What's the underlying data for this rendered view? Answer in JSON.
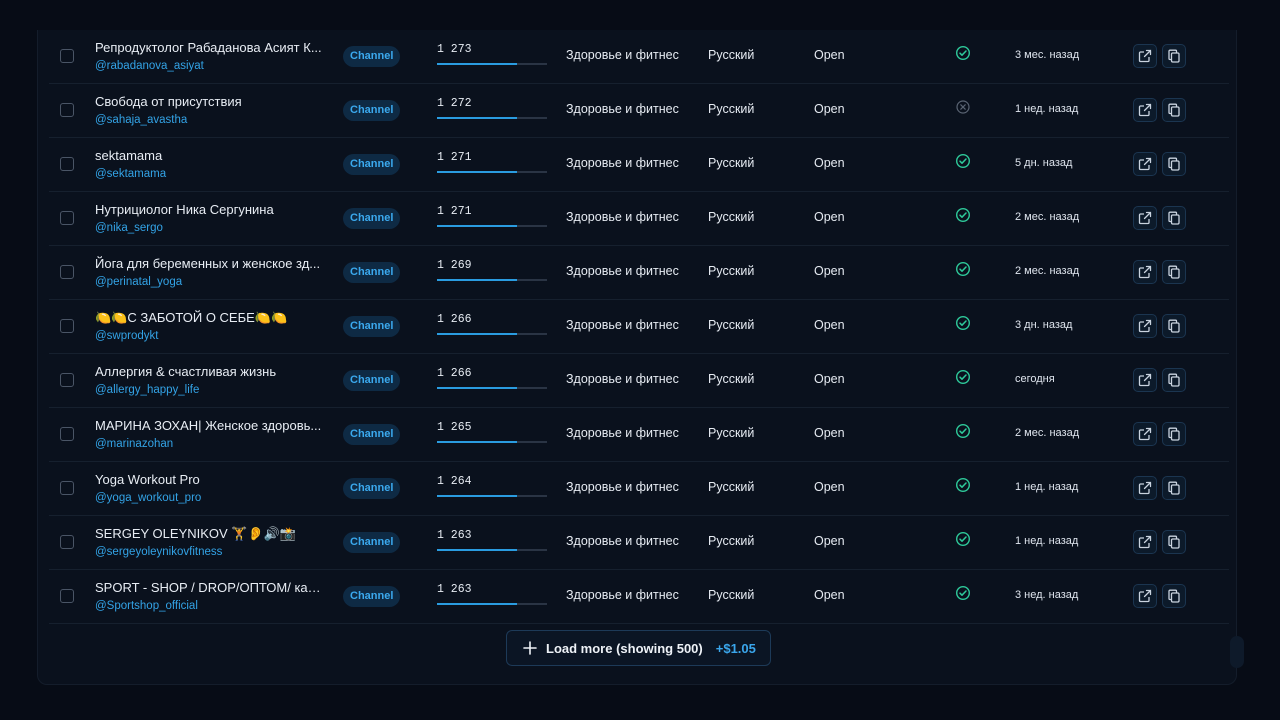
{
  "badge_label": "Channel",
  "colors": {
    "accent": "#2a9ce0",
    "verified": "#2ec99a",
    "unverified": "#5a6473"
  },
  "icons": {
    "verified": "check-circle-icon",
    "unverified": "x-circle-icon",
    "open": "external-link-icon",
    "copy": "copy-icon",
    "load_more": "plus-icon"
  },
  "rows": [
    {
      "name": "Репродуктолог Рабаданова Асият К...",
      "handle": "@rabadanova_asiyat",
      "subscribers": "1 273",
      "fill": 0.73,
      "category": "Здоровье и фитнес",
      "language": "Русский",
      "status": "Open",
      "verified": true,
      "updated": "3 мес. назад"
    },
    {
      "name": "Свобода от присутствия",
      "handle": "@sahaja_avastha",
      "subscribers": "1 272",
      "fill": 0.73,
      "category": "Здоровье и фитнес",
      "language": "Русский",
      "status": "Open",
      "verified": false,
      "updated": "1 нед. назад"
    },
    {
      "name": "sektamama",
      "handle": "@sektamama",
      "subscribers": "1 271",
      "fill": 0.73,
      "category": "Здоровье и фитнес",
      "language": "Русский",
      "status": "Open",
      "verified": true,
      "updated": "5 дн. назад"
    },
    {
      "name": "Нутрициолог Ника Сергунина",
      "handle": "@nika_sergo",
      "subscribers": "1 271",
      "fill": 0.73,
      "category": "Здоровье и фитнес",
      "language": "Русский",
      "status": "Open",
      "verified": true,
      "updated": "2 мес. назад"
    },
    {
      "name": "Йога для беременных и женское зд...",
      "handle": "@perinatal_yoga",
      "subscribers": "1 269",
      "fill": 0.73,
      "category": "Здоровье и фитнес",
      "language": "Русский",
      "status": "Open",
      "verified": true,
      "updated": "2 мес. назад"
    },
    {
      "name": "🍋🍋С ЗАБОТОЙ О СЕБЕ🍋🍋",
      "handle": "@swprodykt",
      "subscribers": "1 266",
      "fill": 0.73,
      "category": "Здоровье и фитнес",
      "language": "Русский",
      "status": "Open",
      "verified": true,
      "updated": "3 дн. назад"
    },
    {
      "name": "Аллергия & счастливая жизнь",
      "handle": "@allergy_happy_life",
      "subscribers": "1 266",
      "fill": 0.73,
      "category": "Здоровье и фитнес",
      "language": "Русский",
      "status": "Open",
      "verified": true,
      "updated": "сегодня"
    },
    {
      "name": "МАРИНА ЗОХАН| Женское здоровь...",
      "handle": "@marinazohan",
      "subscribers": "1 265",
      "fill": 0.73,
      "category": "Здоровье и фитнес",
      "language": "Русский",
      "status": "Open",
      "verified": true,
      "updated": "2 мес. назад"
    },
    {
      "name": "Yoga Workout Pro",
      "handle": "@yoga_workout_pro",
      "subscribers": "1 264",
      "fill": 0.73,
      "category": "Здоровье и фитнес",
      "language": "Русский",
      "status": "Open",
      "verified": true,
      "updated": "1 нед. назад"
    },
    {
      "name": "SERGEY OLEYNIKOV 🏋️👂🔊📸",
      "handle": "@sergeyoleynikovfitness",
      "subscribers": "1 263",
      "fill": 0.73,
      "category": "Здоровье и фитнес",
      "language": "Русский",
      "status": "Open",
      "verified": true,
      "updated": "1 нед. назад"
    },
    {
      "name": "SPORT - SHOP / DROP/ОПТОМ/ кан...",
      "handle": "@Sportshop_official",
      "subscribers": "1 263",
      "fill": 0.73,
      "category": "Здоровье и фитнес",
      "language": "Русский",
      "status": "Open",
      "verified": true,
      "updated": "3 нед. назад"
    }
  ],
  "load_more": {
    "label": "Load more (showing 500)",
    "price": "+$1.05"
  }
}
